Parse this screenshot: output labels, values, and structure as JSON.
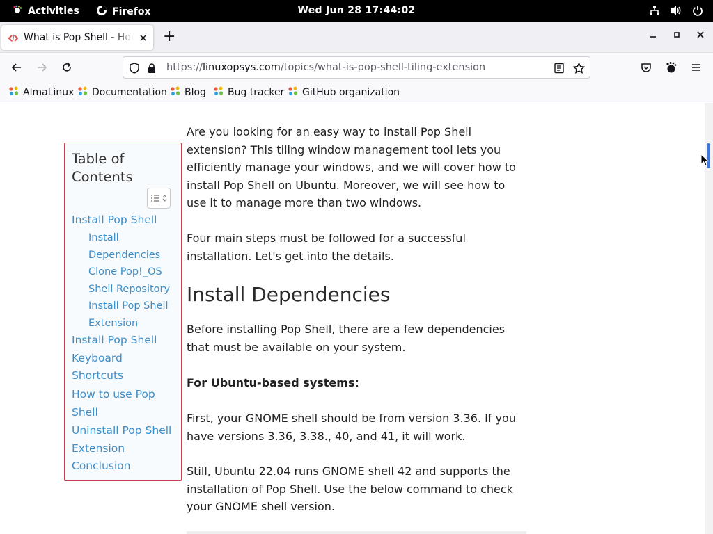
{
  "system": {
    "activities": "Activities",
    "app_name": "Firefox",
    "clock": "Wed Jun 28  17:44:02"
  },
  "browser": {
    "tab": {
      "title": "What is Pop Shell - How to Install Pop Shell"
    },
    "url": {
      "scheme": "https://",
      "domain": "linuxopsys.com",
      "path": "/topics/what-is-pop-shell-tiling-extension"
    },
    "bookmarks": [
      "AlmaLinux",
      "Documentation",
      "Blog",
      "Bug tracker",
      "GitHub organization"
    ],
    "accent": "#3d78d8"
  },
  "toc": {
    "title": "Table of Contents",
    "items": [
      {
        "label": "Install Pop Shell",
        "level": 1
      },
      {
        "label": "Install Dependencies",
        "level": 2
      },
      {
        "label": "Clone Pop!_OS Shell Repository",
        "level": 2
      },
      {
        "label": "Install Pop Shell Extension",
        "level": 2
      },
      {
        "label": "Install Pop Shell Keyboard Shortcuts",
        "level": 1
      },
      {
        "label": "How to use Pop Shell",
        "level": 1
      },
      {
        "label": "Uninstall Pop Shell Extension",
        "level": 1
      },
      {
        "label": "Conclusion",
        "level": 1
      }
    ],
    "border_color": "#c94050",
    "link_color": "#3d8ec9"
  },
  "article": {
    "intro": "Are you looking for an easy way to install Pop Shell extension? This tiling window management tool lets you efficiently manage your windows, and we will cover how to install Pop Shell on Ubuntu. Moreover, we will see how to use it to manage more than two windows.",
    "steps": "Four main steps must be followed for a successful installation. Let's get into the details.",
    "heading": "Install Dependencies",
    "deps_intro": "Before installing Pop Shell, there are a few dependencies that must be available on your system.",
    "ubuntu_label": "For Ubuntu-based systems:",
    "gnome_version": "First, your GNOME shell should be from version 3.36. If you have versions 3.36, 3.38., 40, and 41, it will work.",
    "ubuntu_2204": "Still, Ubuntu 22.04 runs GNOME shell 42 and supports the installation of Pop Shell. Use the below command to check your GNOME shell version."
  }
}
